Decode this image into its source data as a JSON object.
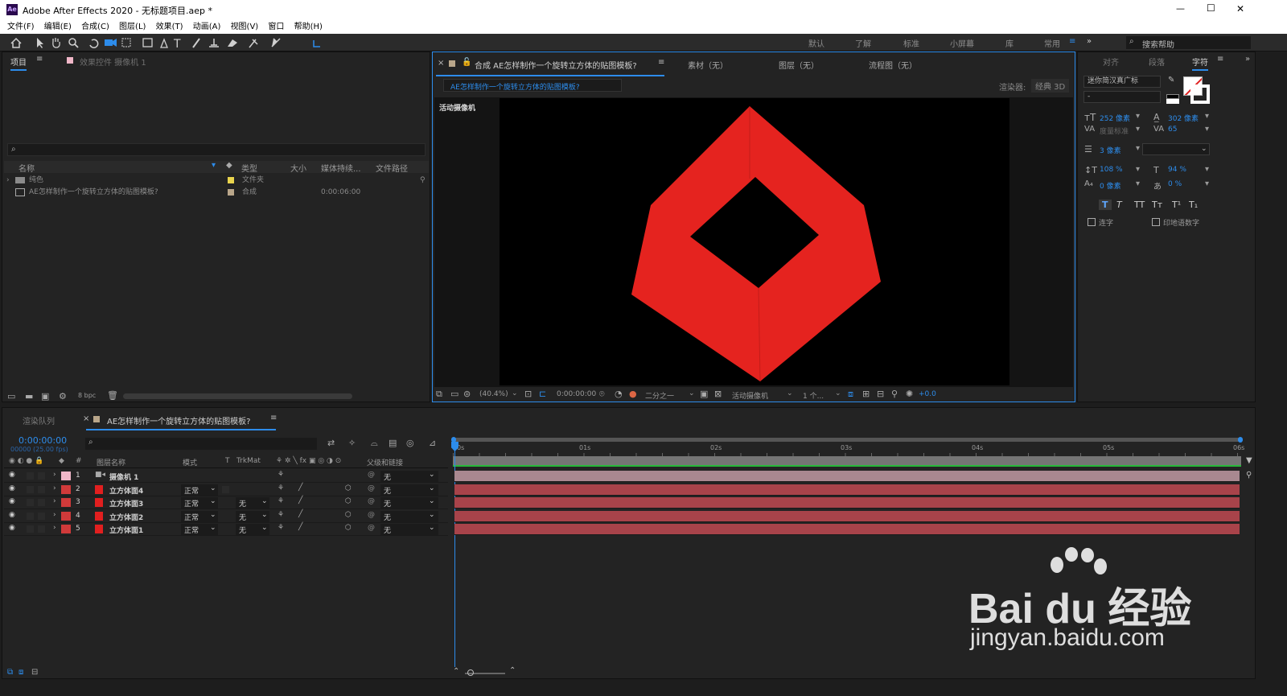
{
  "window": {
    "app_icon": "Ae",
    "title": "Adobe After Effects 2020 - 无标题项目.aep *",
    "minimize": "—",
    "maximize": "☐",
    "close": "✕"
  },
  "menu": [
    "文件(F)",
    "编辑(E)",
    "合成(C)",
    "图层(L)",
    "效果(T)",
    "动画(A)",
    "视图(V)",
    "窗口",
    "帮助(H)"
  ],
  "workspaces": [
    "默认",
    "了解",
    "标准",
    "小屏幕",
    "库",
    "常用"
  ],
  "search_help": "搜索帮助",
  "project_panel": {
    "tab_project": "项目",
    "tab_effects": "效果控件 摄像机 1",
    "columns": [
      "名称",
      "类型",
      "大小",
      "媒体持续...",
      "文件路径"
    ],
    "items": [
      {
        "name": "纯色",
        "type": "文件夹",
        "duration": ""
      },
      {
        "name": "AE怎样制作一个旋转立方体的贴图模板?",
        "type": "合成",
        "duration": "0:00:06:00"
      }
    ],
    "bpc": "8 bpc"
  },
  "comp_panel": {
    "tab_comp": "合成 AE怎样制作一个旋转立方体的贴图模板?",
    "tab_footage": "素材（无）",
    "tab_layer": "图层（无）",
    "tab_flow": "流程图（无）",
    "breadcrumb": "AE怎样制作一个旋转立方体的贴图模板?",
    "renderer_label": "渲染器:",
    "renderer_value": "经典 3D",
    "active_camera_label": "活动摄像机",
    "shape_color": "#e5231f",
    "zoom": "(40.4%)",
    "timecode": "0:00:00:00",
    "resolution": "二分之一",
    "camera": "活动摄像机",
    "views": "1 个...",
    "exposure": "+0.0"
  },
  "character_panel": {
    "tabs": [
      "对齐",
      "段落",
      "字符"
    ],
    "font": "迷你简汉真广标",
    "style": "-",
    "font_size": "252 像素",
    "leading": "302 像素",
    "kerning": "度量标准",
    "tracking": "65",
    "stroke": "3 像素",
    "v_scale": "108 %",
    "h_scale": "94 %",
    "baseline": "0 像素",
    "tsume": "0 %",
    "ligature": "连字",
    "hindi": "印地语数字"
  },
  "timeline": {
    "tab_render": "渲染队列",
    "tab_comp": "AE怎样制作一个旋转立方体的贴图模板?",
    "timecode": "0:00:00:00",
    "fps": "00000 (25.00 fps)",
    "columns": {
      "name": "图层名称",
      "mode": "模式",
      "t": "T",
      "trkmat": "TrkMat",
      "parent": "父级和链接"
    },
    "ruler": [
      "0s",
      "01s",
      "02s",
      "03s",
      "04s",
      "05s",
      "06s"
    ],
    "layers": [
      {
        "num": "1",
        "name": "摄像机 1",
        "mode": "",
        "trkmat": "",
        "parent": "无",
        "color": "#f0b7c8"
      },
      {
        "num": "2",
        "name": "立方体面4",
        "mode": "正常",
        "trkmat": "",
        "parent": "无",
        "color": "#d03a3a"
      },
      {
        "num": "3",
        "name": "立方体面3",
        "mode": "正常",
        "trkmat": "无",
        "parent": "无",
        "color": "#d03a3a"
      },
      {
        "num": "4",
        "name": "立方体面2",
        "mode": "正常",
        "trkmat": "无",
        "parent": "无",
        "color": "#d03a3a"
      },
      {
        "num": "5",
        "name": "立方体面1",
        "mode": "正常",
        "trkmat": "无",
        "parent": "无",
        "color": "#d03a3a"
      }
    ]
  },
  "watermark": {
    "brand": "Bai du 经验",
    "url": "jingyan.baidu.com"
  }
}
